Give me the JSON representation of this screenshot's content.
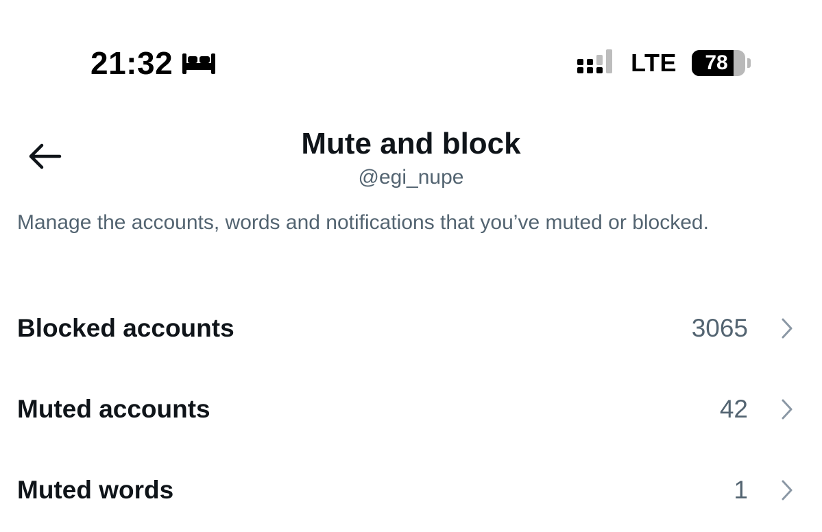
{
  "status_bar": {
    "time": "21:32",
    "focus_icon": "bed-icon",
    "signal_icon": "cellular-signal-icon",
    "network": "LTE",
    "battery_level": "78",
    "battery_percent": 78
  },
  "header": {
    "back_icon": "arrow-left-icon",
    "title": "Mute and block",
    "subtitle": "@egi_nupe"
  },
  "description": "Manage the accounts, words and notifications that you’ve muted or blocked.",
  "list": {
    "items": [
      {
        "label": "Blocked accounts",
        "count": "3065"
      },
      {
        "label": "Muted accounts",
        "count": "42"
      },
      {
        "label": "Muted words",
        "count": "1"
      }
    ],
    "chevron_icon": "chevron-right-icon"
  },
  "colors": {
    "primary_text": "#0f1419",
    "secondary_text": "#536471",
    "chevron": "#8b98a5",
    "background": "#ffffff"
  }
}
